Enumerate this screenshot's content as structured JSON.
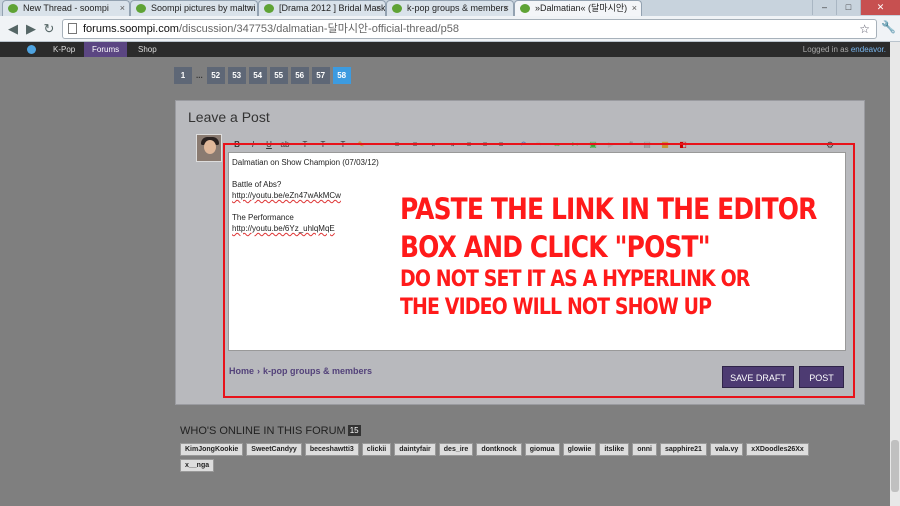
{
  "browser": {
    "tabs": [
      {
        "title": "New Thread - soompi"
      },
      {
        "title": "Soompi pictures by maltwi"
      },
      {
        "title": "[Drama 2012 ] Bridal Mask"
      },
      {
        "title": "k-pop groups & members"
      },
      {
        "title": "»Dalmatian« (달마시안)"
      }
    ],
    "url_domain": "forums.soompi.com",
    "url_path": "/discussion/347753/dalmatian-달마시안-official-thread/p58"
  },
  "sitenav": {
    "items": [
      "K-Pop",
      "Forums",
      "Shop"
    ],
    "login_prefix": "Logged in as",
    "username": "endeavor."
  },
  "pagination": {
    "pages": [
      "1",
      "...",
      "52",
      "53",
      "54",
      "55",
      "56",
      "57",
      "58"
    ],
    "current": "58"
  },
  "leave_post": {
    "title": "Leave a Post",
    "editor_lines": [
      "Dalmatian on Show Champion (07/03/12)",
      "",
      "Battle of Abs?",
      "http://youtu.be/eZn47wAkMCw",
      "",
      "The Performance",
      "http://youtu.be/6Yz_uhlqMqE"
    ],
    "breadcrumb_home": "Home",
    "breadcrumb_sep": "›",
    "breadcrumb_category": "k-pop groups & members",
    "save_draft": "SAVE DRAFT",
    "post": "POST"
  },
  "annotation": {
    "line1": "Paste the link in the editor",
    "line2": "box and click \"post\"",
    "line3": "do not set it as a hyperlink or",
    "line4": "the video will not show up"
  },
  "whos_online": {
    "title": "WHO'S ONLINE IN THIS FORUM",
    "count": "15",
    "users": [
      "KimJongKookie",
      "SweetCandyy",
      "beceshawtti3",
      "clickii",
      "daintyfair",
      "des_ire",
      "dontknock",
      "giomua",
      "glowiie",
      "itslike",
      "onni",
      "sapphire21",
      "vala.vy",
      "xXDoodles26Xx",
      "x__nga"
    ]
  },
  "colors": {
    "accent_purple": "#4d3b72",
    "annotation_red": "#ff1a1a",
    "current_page_blue": "#3c9be0"
  }
}
